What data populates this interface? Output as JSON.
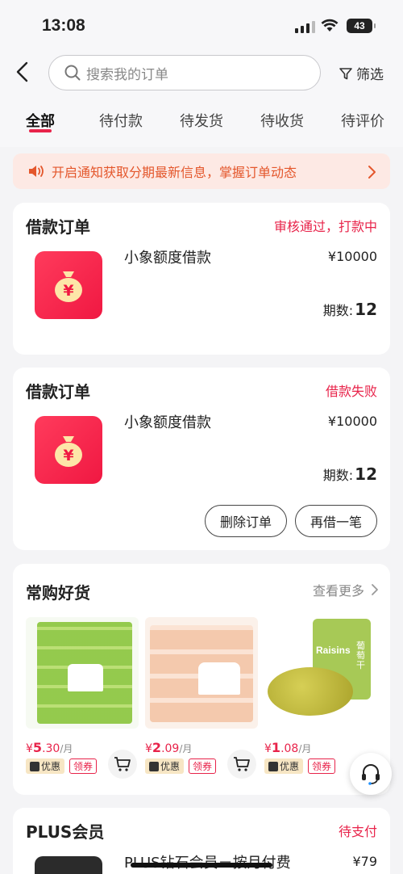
{
  "status_bar": {
    "time": "13:08",
    "battery": "43"
  },
  "header": {
    "search_placeholder": "搜索我的订单",
    "filter_label": "筛选",
    "tabs": [
      {
        "label": "全部",
        "active": true
      },
      {
        "label": "待付款"
      },
      {
        "label": "待发货"
      },
      {
        "label": "待收货"
      },
      {
        "label": "待评价"
      }
    ]
  },
  "notice": {
    "text": "开启通知获取分期最新信息，掌握订单动态"
  },
  "orders": [
    {
      "title": "借款订单",
      "status": "审核通过，打款中",
      "product": "小象额度借款",
      "price": "¥10000",
      "periods_label": "期数:",
      "periods": "12"
    },
    {
      "title": "借款订单",
      "status": "借款失败",
      "product": "小象额度借款",
      "price": "¥10000",
      "periods_label": "期数:",
      "periods": "12",
      "buttons": {
        "delete": "删除订单",
        "reborrow": "再借一笔"
      }
    }
  ],
  "goods": {
    "title": "常购好货",
    "more": "查看更多",
    "items": [
      {
        "price_int": "5",
        "price_dec": ".30",
        "per": "/月",
        "tag_discount": "优惠",
        "tag_coupon": "领券"
      },
      {
        "price_int": "2",
        "price_dec": ".09",
        "per": "/月",
        "tag_discount": "优惠",
        "tag_coupon": "领券"
      },
      {
        "price_int": "1",
        "price_dec": ".08",
        "per": "/月",
        "tag_discount": "优惠",
        "tag_coupon": "领券",
        "image_text_1": "Raisins",
        "image_text_2": "葡萄干"
      }
    ],
    "currency": "¥"
  },
  "plus": {
    "title": "PLUS会员",
    "status": "待支付",
    "product": "PLUS钻石会员－按月付费",
    "price": "¥79"
  },
  "colors": {
    "accent": "#e8234a",
    "notice_text": "#e4572c",
    "notice_bg": "#fde9e4"
  }
}
